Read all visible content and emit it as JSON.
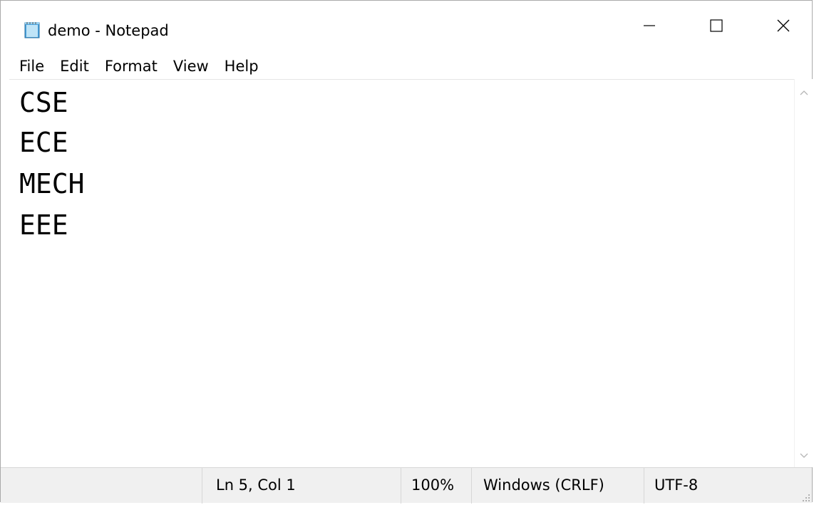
{
  "window": {
    "title": "demo - Notepad",
    "icon": "notepad-icon"
  },
  "controls": {
    "minimize_icon": "minimize-icon",
    "maximize_icon": "maximize-icon",
    "close_icon": "close-icon"
  },
  "menu": {
    "items": [
      {
        "label": "File"
      },
      {
        "label": "Edit"
      },
      {
        "label": "Format"
      },
      {
        "label": "View"
      },
      {
        "label": "Help"
      }
    ]
  },
  "editor": {
    "lines": [
      "CSE",
      "ECE",
      "MECH",
      "EEE"
    ]
  },
  "status": {
    "position": "Ln 5, Col 1",
    "zoom": "100%",
    "line_ending": "Windows (CRLF)",
    "encoding": "UTF-8"
  },
  "colors": {
    "status_bar_bg": "#f0f0f0",
    "text": "#000000",
    "window_border": "#aaaaaa"
  }
}
